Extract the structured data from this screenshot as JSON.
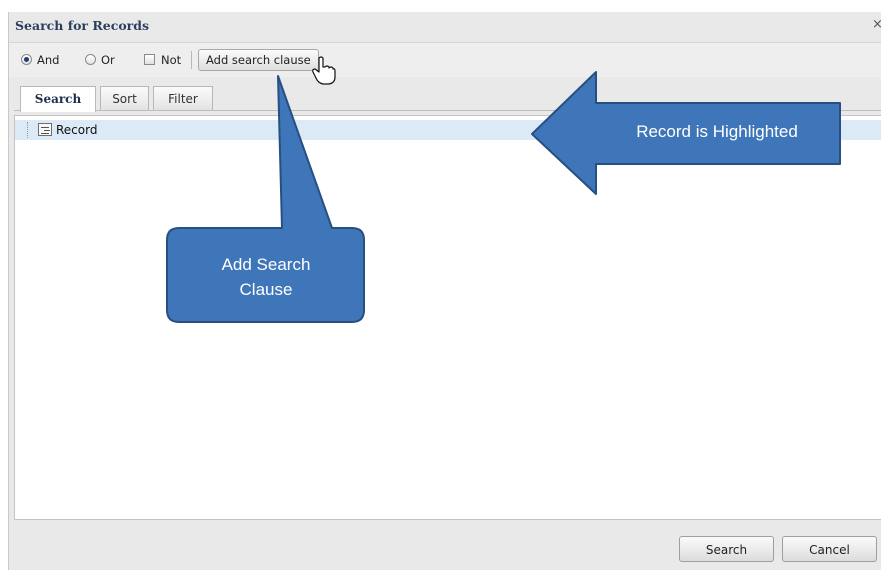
{
  "dialog": {
    "title": "Search for Records",
    "close_label": "×"
  },
  "toolbar": {
    "and_label": "And",
    "or_label": "Or",
    "not_label": "Not",
    "add_clause_label": "Add search clause",
    "logic_selected": "And",
    "not_checked": false
  },
  "tabs": [
    {
      "label": "Search",
      "active": true
    },
    {
      "label": "Sort",
      "active": false
    },
    {
      "label": "Filter",
      "active": false
    }
  ],
  "tree": {
    "items": [
      {
        "label": "Record",
        "highlighted": true
      }
    ]
  },
  "footer": {
    "search_label": "Search",
    "cancel_label": "Cancel"
  },
  "callouts": {
    "record": {
      "text": "Record is Highlighted"
    },
    "add_clause": {
      "line1": "Add Search",
      "line2": "Clause"
    }
  },
  "colors": {
    "callout_fill": "#3f76b9",
    "callout_stroke": "#274f81",
    "highlight_row": "#dce9f7"
  }
}
